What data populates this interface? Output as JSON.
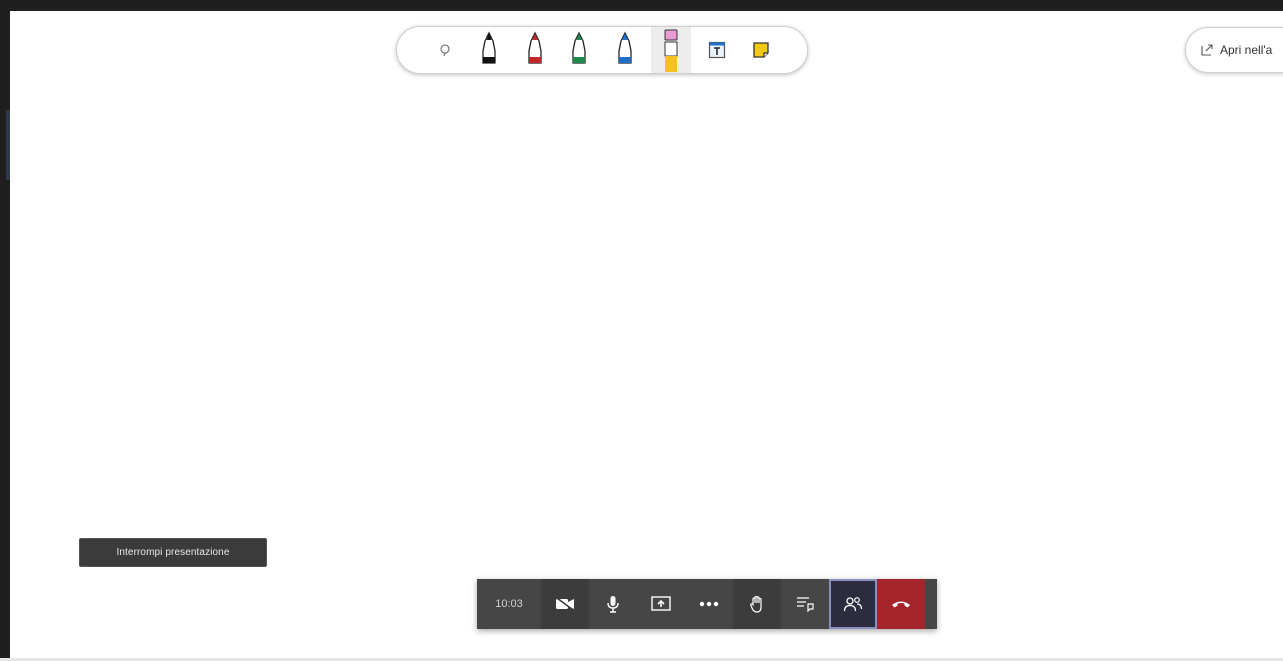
{
  "window": {
    "accent_color": "#a4262c",
    "bar_color": "#464646"
  },
  "ink_toolbar": {
    "tools": [
      {
        "name": "lasso-select-icon",
        "color": "#777777"
      },
      {
        "name": "black-pen-icon",
        "color": "#111111"
      },
      {
        "name": "red-pen-icon",
        "color": "#c4262e"
      },
      {
        "name": "green-pen-icon",
        "color": "#1e8a4c"
      },
      {
        "name": "blue-pen-icon",
        "color": "#1f6fc5"
      },
      {
        "name": "highlighter-icon",
        "color": "#f3c02a",
        "selected": true
      },
      {
        "name": "text-box-icon",
        "color": "#1f6fc5"
      },
      {
        "name": "sticky-note-icon",
        "color": "#f2c811"
      }
    ]
  },
  "open_in_app": {
    "label": "Apri nell'a"
  },
  "presentation": {
    "stop_label": "Interrompi presentazione"
  },
  "call_bar": {
    "timer": "10:03",
    "buttons": [
      {
        "name": "camera-icon"
      },
      {
        "name": "microphone-icon"
      },
      {
        "name": "share-screen-icon"
      },
      {
        "name": "more-actions-icon"
      },
      {
        "name": "raise-hand-icon"
      },
      {
        "name": "chat-icon"
      },
      {
        "name": "participants-icon"
      },
      {
        "name": "hang-up-icon"
      }
    ]
  }
}
